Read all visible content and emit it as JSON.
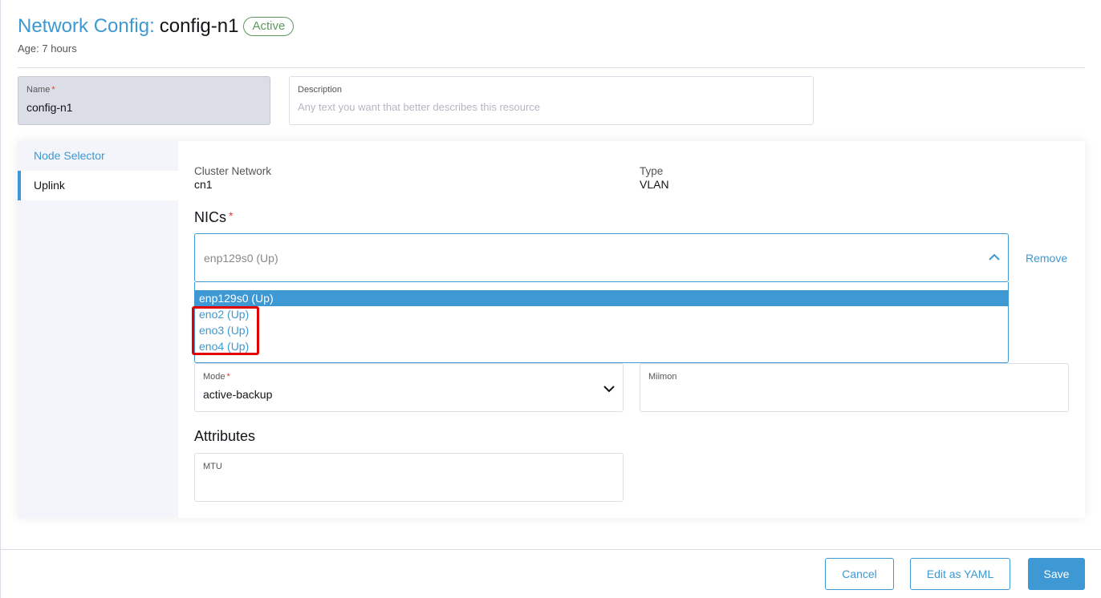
{
  "header": {
    "title_link": "Network Config:",
    "title_name": "config-n1",
    "status_badge": "Active",
    "age_label": "Age:",
    "age_value": "7 hours"
  },
  "form": {
    "name": {
      "label": "Name",
      "required_mark": "*",
      "value": "config-n1"
    },
    "description": {
      "label": "Description",
      "placeholder": "Any text you want that better describes this resource"
    }
  },
  "tabs": [
    {
      "label": "Node Selector",
      "active": false
    },
    {
      "label": "Uplink",
      "active": true
    }
  ],
  "uplink": {
    "cluster_network": {
      "label": "Cluster Network",
      "value": "cn1"
    },
    "type": {
      "label": "Type",
      "value": "VLAN"
    },
    "nics": {
      "title": "NICs",
      "required_mark": "*",
      "selected_value": "enp129s0 (Up)",
      "remove_label": "Remove",
      "options": [
        "enp129s0 (Up)",
        "eno2 (Up)",
        "eno3 (Up)",
        "eno4 (Up)"
      ]
    },
    "mode": {
      "label": "Mode",
      "required_mark": "*",
      "value": "active-backup"
    },
    "miimon": {
      "label": "Miimon",
      "value": ""
    },
    "attributes": {
      "title": "Attributes",
      "mtu": {
        "label": "MTU",
        "value": ""
      }
    }
  },
  "footer": {
    "cancel_label": "Cancel",
    "edit_yaml_label": "Edit as YAML",
    "save_label": "Save"
  },
  "colors": {
    "accent": "#3d98d3",
    "active_badge": "#5d995d",
    "required": "#e03b3b",
    "highlight": "#e00000"
  },
  "icons": {
    "nics_dropdown": "chevron-up-icon",
    "mode_dropdown": "chevron-down-icon"
  }
}
